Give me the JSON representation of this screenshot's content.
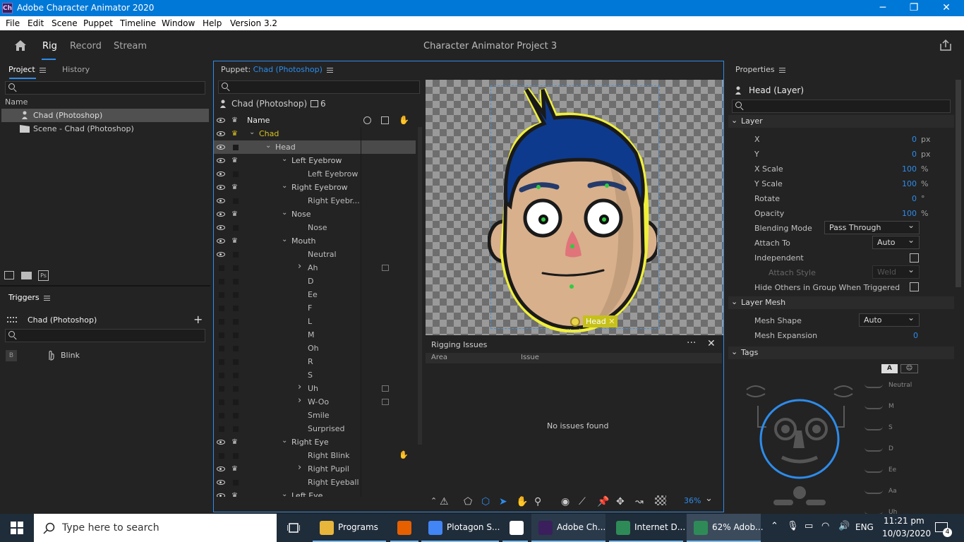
{
  "titlebar": {
    "app_icon": "Ch",
    "title": "Adobe Character Animator 2020"
  },
  "menubar": {
    "items": [
      "File",
      "Edit",
      "Scene",
      "Puppet",
      "Timeline",
      "Window",
      "Help",
      "Version 3.2"
    ]
  },
  "workspace": {
    "tabs": [
      "Rig",
      "Record",
      "Stream"
    ],
    "active": "Rig",
    "project_title": "Character Animator Project 3"
  },
  "project_panel": {
    "tabs": [
      "Project",
      "History"
    ],
    "column_name": "Name",
    "items": [
      {
        "label": "Chad (Photoshop)",
        "icon": "puppet-icon",
        "selected": true
      },
      {
        "label": "Scene - Chad (Photoshop)",
        "icon": "scene-icon",
        "selected": false
      }
    ]
  },
  "triggers_panel": {
    "title": "Triggers",
    "puppet": "Chad (Photoshop)",
    "trigger_key": "B",
    "trigger_name": "Blink"
  },
  "puppet_panel": {
    "title_prefix": "Puppet:",
    "title_name": "Chad (Photoshop)",
    "puppet_name": "Chad (Photoshop)",
    "count": "6",
    "column_name": "Name",
    "layers": [
      {
        "label": "Chad",
        "depth": 0,
        "expanded": true,
        "eye": true,
        "crown": true,
        "group": true,
        "highlight": "gold"
      },
      {
        "label": "Head",
        "depth": 1,
        "expanded": true,
        "eye": true,
        "crown": false,
        "group": true,
        "selected": true
      },
      {
        "label": "Left Eyebrow",
        "depth": 2,
        "expanded": true,
        "eye": true,
        "crown": true,
        "group": true
      },
      {
        "label": "Left Eyebrow",
        "depth": 3,
        "eye": true
      },
      {
        "label": "Right Eyebrow",
        "depth": 2,
        "expanded": true,
        "eye": true,
        "crown": true,
        "group": true
      },
      {
        "label": "Right Eyebr...",
        "depth": 3,
        "eye": true
      },
      {
        "label": "Nose",
        "depth": 2,
        "expanded": true,
        "eye": true,
        "crown": true,
        "group": true
      },
      {
        "label": "Nose",
        "depth": 3,
        "eye": true
      },
      {
        "label": "Mouth",
        "depth": 2,
        "expanded": true,
        "eye": true,
        "crown": true,
        "group": true
      },
      {
        "label": "Neutral",
        "depth": 3,
        "eye": true
      },
      {
        "label": "Ah",
        "depth": 3,
        "collapsed": true,
        "badge": true
      },
      {
        "label": "D",
        "depth": 3
      },
      {
        "label": "Ee",
        "depth": 3
      },
      {
        "label": "F",
        "depth": 3
      },
      {
        "label": "L",
        "depth": 3
      },
      {
        "label": "M",
        "depth": 3
      },
      {
        "label": "Oh",
        "depth": 3
      },
      {
        "label": "R",
        "depth": 3
      },
      {
        "label": "S",
        "depth": 3
      },
      {
        "label": "Uh",
        "depth": 3,
        "collapsed": true,
        "badge": true
      },
      {
        "label": "W-Oo",
        "depth": 3,
        "collapsed": true,
        "badge": true
      },
      {
        "label": "Smile",
        "depth": 3
      },
      {
        "label": "Surprised",
        "depth": 3
      },
      {
        "label": "Right Eye",
        "depth": 2,
        "expanded": true,
        "eye": true,
        "crown": true,
        "group": true
      },
      {
        "label": "Right Blink",
        "depth": 3,
        "trigger": true
      },
      {
        "label": "Right Pupil",
        "depth": 3,
        "collapsed": true,
        "eye": true,
        "crown": true
      },
      {
        "label": "Right Eyeball",
        "depth": 3,
        "eye": true
      },
      {
        "label": "Left Eye",
        "depth": 2,
        "expanded": true,
        "eye": true,
        "crown": true,
        "group": true
      }
    ]
  },
  "canvas": {
    "handle_label": "Head",
    "handle_sub": "Head",
    "zoom": "36%"
  },
  "rigging_issues": {
    "title": "Rigging Issues",
    "col_area": "Area",
    "col_issue": "Issue",
    "empty_text": "No issues found"
  },
  "properties": {
    "title": "Properties",
    "layer_name": "Head (Layer)",
    "section_layer": "Layer",
    "x": {
      "label": "X",
      "value": "0",
      "unit": "px"
    },
    "y": {
      "label": "Y",
      "value": "0",
      "unit": "px"
    },
    "xscale": {
      "label": "X Scale",
      "value": "100",
      "unit": "%"
    },
    "yscale": {
      "label": "Y Scale",
      "value": "100",
      "unit": "%"
    },
    "rotate": {
      "label": "Rotate",
      "value": "0",
      "unit": "°"
    },
    "opacity": {
      "label": "Opacity",
      "value": "100",
      "unit": "%"
    },
    "blending": {
      "label": "Blending Mode",
      "value": "Pass Through"
    },
    "attach_to": {
      "label": "Attach To",
      "value": "Auto"
    },
    "independent": {
      "label": "Independent"
    },
    "attach_style": {
      "label": "Attach Style",
      "value": "Weld"
    },
    "hide_others": {
      "label": "Hide Others in Group When Triggered"
    },
    "section_mesh": "Layer Mesh",
    "mesh_shape": {
      "label": "Mesh Shape",
      "value": "Auto"
    },
    "mesh_expansion": {
      "label": "Mesh Expansion",
      "value": "0"
    },
    "section_tags": "Tags",
    "tag_toggle": "A",
    "mouth_tags": [
      "Neutral",
      "M",
      "S",
      "D",
      "Ee",
      "Aa",
      "Uh"
    ]
  },
  "taskbar": {
    "search_placeholder": "Type here to search",
    "items": [
      {
        "label": "Programs",
        "color": "#e8b63a"
      },
      {
        "label": "",
        "color": "#e66000"
      },
      {
        "label": "Plotagon S...",
        "color": "#4285f4"
      },
      {
        "label": "",
        "color": "#ffffff"
      },
      {
        "label": "Adobe Ch...",
        "color": "#3a1f5c"
      },
      {
        "label": "Internet D...",
        "color": "#2e8b57"
      },
      {
        "label": "62% Adob...",
        "color": "#2e8b57"
      }
    ],
    "lang": "ENG",
    "time": "11:21 pm",
    "date": "10/03/2020",
    "notif_count": "4"
  }
}
